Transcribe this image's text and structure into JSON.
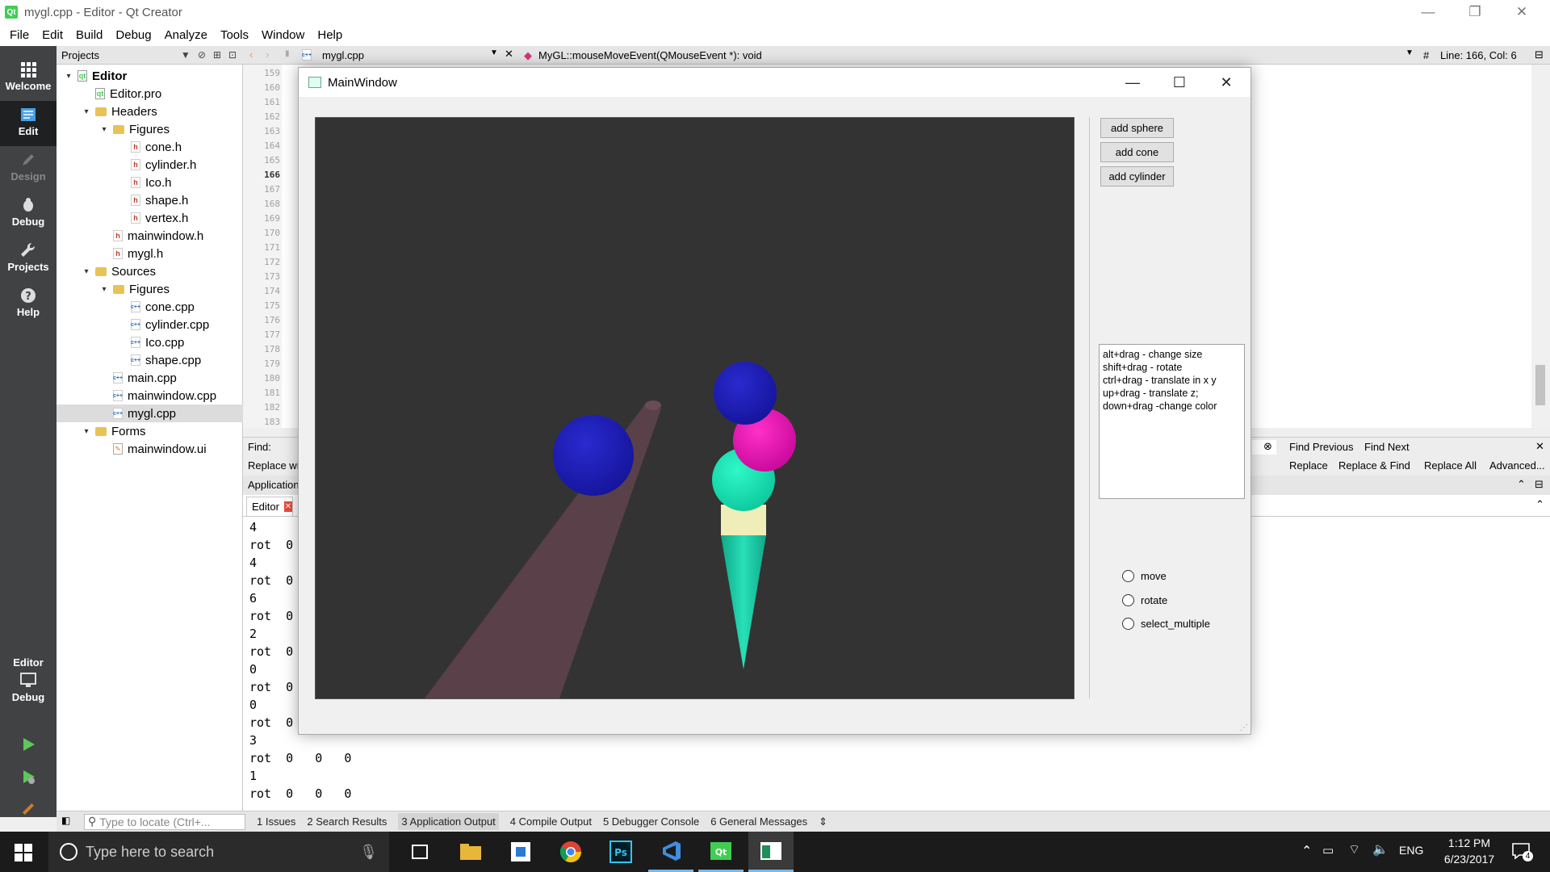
{
  "window": {
    "title": "mygl.cpp - Editor - Qt Creator"
  },
  "menu": [
    "File",
    "Edit",
    "Build",
    "Debug",
    "Analyze",
    "Tools",
    "Window",
    "Help"
  ],
  "modes": [
    {
      "label": "Welcome",
      "icon": "grid-icon"
    },
    {
      "label": "Edit",
      "icon": "edit-icon"
    },
    {
      "label": "Design",
      "icon": "pencil-icon"
    },
    {
      "label": "Debug",
      "icon": "bug-icon"
    },
    {
      "label": "Projects",
      "icon": "wrench-icon"
    },
    {
      "label": "Help",
      "icon": "help-icon"
    }
  ],
  "kit": {
    "project": "Editor",
    "mode": "Debug"
  },
  "projects": {
    "header": "Projects",
    "tree": [
      {
        "label": "Editor",
        "type": "pro-root",
        "depth": 0,
        "arrow": "▾"
      },
      {
        "label": "Editor.pro",
        "type": "pro",
        "depth": 1,
        "arrow": ""
      },
      {
        "label": "Headers",
        "type": "folder-h",
        "depth": 1,
        "arrow": "▾"
      },
      {
        "label": "Figures",
        "type": "folder",
        "depth": 2,
        "arrow": "▾"
      },
      {
        "label": "cone.h",
        "type": "h",
        "depth": 3,
        "arrow": ""
      },
      {
        "label": "cylinder.h",
        "type": "h",
        "depth": 3,
        "arrow": ""
      },
      {
        "label": "Ico.h",
        "type": "h",
        "depth": 3,
        "arrow": ""
      },
      {
        "label": "shape.h",
        "type": "h",
        "depth": 3,
        "arrow": ""
      },
      {
        "label": "vertex.h",
        "type": "h",
        "depth": 3,
        "arrow": ""
      },
      {
        "label": "mainwindow.h",
        "type": "h",
        "depth": 2,
        "arrow": ""
      },
      {
        "label": "mygl.h",
        "type": "h",
        "depth": 2,
        "arrow": ""
      },
      {
        "label": "Sources",
        "type": "folder-c",
        "depth": 1,
        "arrow": "▾"
      },
      {
        "label": "Figures",
        "type": "folder",
        "depth": 2,
        "arrow": "▾"
      },
      {
        "label": "cone.cpp",
        "type": "cpp",
        "depth": 3,
        "arrow": ""
      },
      {
        "label": "cylinder.cpp",
        "type": "cpp",
        "depth": 3,
        "arrow": ""
      },
      {
        "label": "Ico.cpp",
        "type": "cpp",
        "depth": 3,
        "arrow": ""
      },
      {
        "label": "shape.cpp",
        "type": "cpp",
        "depth": 3,
        "arrow": ""
      },
      {
        "label": "main.cpp",
        "type": "cpp",
        "depth": 2,
        "arrow": ""
      },
      {
        "label": "mainwindow.cpp",
        "type": "cpp",
        "depth": 2,
        "arrow": ""
      },
      {
        "label": "mygl.cpp",
        "type": "cpp",
        "depth": 2,
        "arrow": "",
        "selected": true
      },
      {
        "label": "Forms",
        "type": "folder-f",
        "depth": 1,
        "arrow": "▾"
      },
      {
        "label": "mainwindow.ui",
        "type": "ui",
        "depth": 2,
        "arrow": ""
      }
    ]
  },
  "editor": {
    "file_tab": "mygl.cpp",
    "symbol": "MyGL::mouseMoveEvent(QMouseEvent *): void",
    "position_hash": "#",
    "position": "Line: 166, Col: 6",
    "line_numbers": [
      "159",
      "160",
      "161",
      "162",
      "163",
      "164",
      "165",
      "166",
      "167",
      "168",
      "169",
      "170",
      "171",
      "172",
      "173",
      "174",
      "175",
      "176",
      "177",
      "178",
      "179",
      "180",
      "181",
      "182",
      "183"
    ],
    "current_line": "166"
  },
  "find": {
    "find_label": "Find:",
    "replace_label": "Replace wi",
    "find_previous": "Find Previous",
    "find_next": "Find Next",
    "replace": "Replace",
    "replace_find": "Replace & Find",
    "replace_all": "Replace All",
    "advanced": "Advanced..."
  },
  "output": {
    "header": "Application",
    "tab": "Editor",
    "lines": [
      "4",
      "rot  0",
      "4",
      "rot  0",
      "6",
      "rot  0",
      "2",
      "rot  0",
      "0",
      "rot  0",
      "0",
      "rot  0",
      "3",
      "rot  0   0   0",
      "1",
      "rot  0   0   0"
    ]
  },
  "status": {
    "locator_placeholder": "Type to locate (Ctrl+...",
    "tabs": [
      "1  Issues",
      "2  Search Results",
      "3  Application Output",
      "4  Compile Output",
      "5  Debugger Console",
      "6  General Messages"
    ]
  },
  "mainwindow": {
    "title": "MainWindow",
    "buttons": {
      "sphere": "add sphere",
      "cone": "add cone",
      "cylinder": "add cylinder"
    },
    "help_lines": [
      "alt+drag - change size",
      "shift+drag - rotate",
      "ctrl+drag - translate in x y",
      "up+drag  - translate z;",
      "down+drag -change color"
    ],
    "radios": [
      "move",
      "rotate",
      "select_multiple"
    ],
    "colors": {
      "viewport": "#333333",
      "sphere_blue": "#1c1cb4",
      "sphere_magenta": "#ee10b0",
      "sphere_teal": "#10e0b0",
      "cone": "#1ad0a8",
      "cylinder_band": "#f0eeb8",
      "rod": "#5a4048"
    }
  },
  "taskbar": {
    "search_placeholder": "Type here to search",
    "time": "1:12 PM",
    "date": "6/23/2017",
    "language": "ENG",
    "notifications": "4"
  }
}
